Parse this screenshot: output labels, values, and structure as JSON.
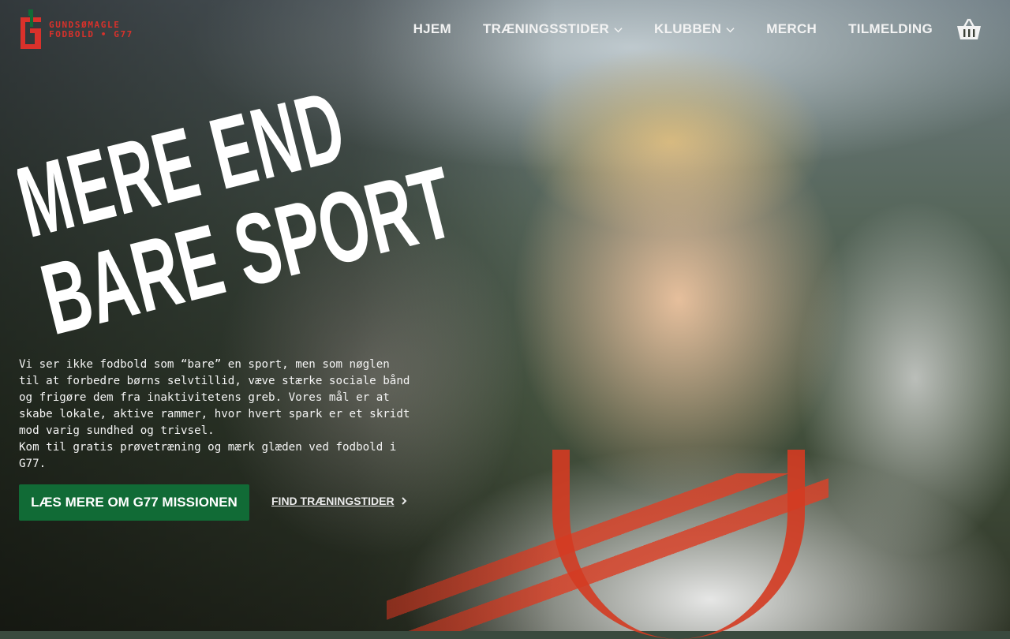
{
  "brand": {
    "line1": "GUNDSØMAGLE",
    "line2": "FODBOLD • G77",
    "colors": {
      "red": "#d9312b",
      "green": "#116b36"
    }
  },
  "nav": {
    "items": [
      {
        "label": "HJEM",
        "has_dropdown": false
      },
      {
        "label": "TRÆNINGSSTIDER",
        "has_dropdown": true
      },
      {
        "label": "KLUBBEN",
        "has_dropdown": true
      },
      {
        "label": "MERCH",
        "has_dropdown": false
      },
      {
        "label": "TILMELDING",
        "has_dropdown": false
      }
    ],
    "cart_icon": "basket-icon"
  },
  "hero": {
    "title_line1": "MERE END",
    "title_line2": "BARE SPORT",
    "description": "Vi ser ikke fodbold som “bare” en sport, men som nøglen til at forbedre børns selvtillid, væve stærke sociale bånd og frigøre dem fra inaktivitetens greb. Vores mål er at skabe lokale, aktive rammer, hvor hvert spark er et skridt mod varig sundhed og trivsel.",
    "invite": "Kom til gratis prøvetræning og mærk glæden ved fodbold i G77.",
    "cta_label": "LÆS MERE OM G77 MISSIONEN",
    "link_label": "FIND TRÆNINGSTIDER"
  }
}
